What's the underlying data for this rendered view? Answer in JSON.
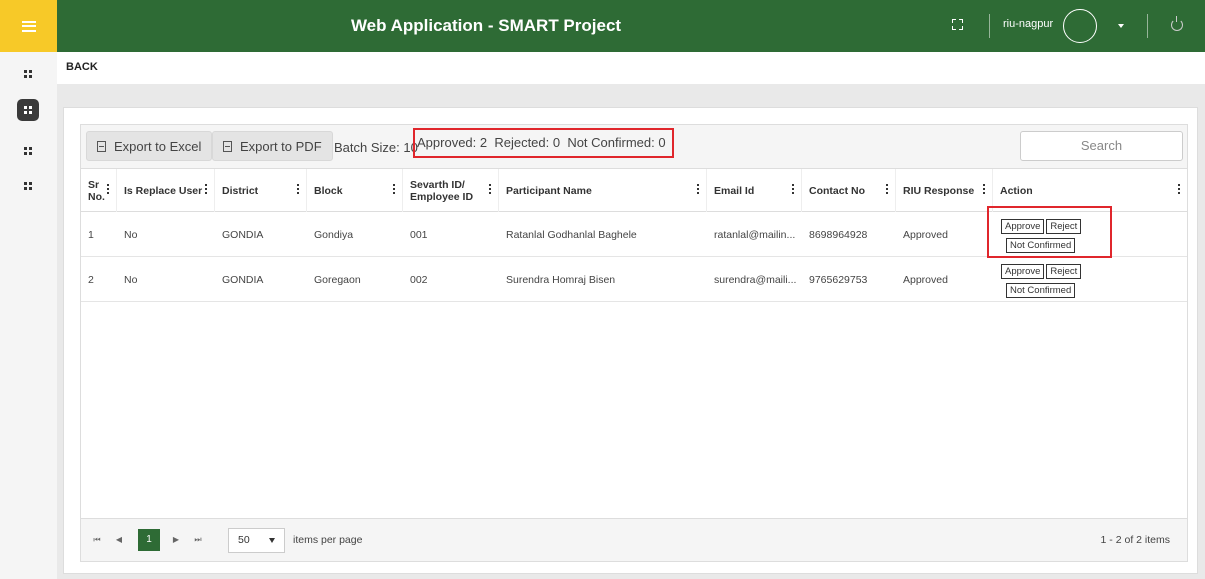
{
  "header": {
    "title": "Web Application - SMART Project",
    "user": "riu-nagpur"
  },
  "nav": {
    "back_label": "BACK"
  },
  "toolbar": {
    "export_excel": "Export to Excel",
    "export_pdf": "Export to PDF",
    "batch_size": "Batch Size: 10",
    "counts": "Approved: 2  Rejected: 0  Not Confirmed: 0",
    "search_placeholder": "Search"
  },
  "table": {
    "columns": [
      "Sr No.",
      "Is Replace User",
      "District",
      "Block",
      "Sevarth ID/ Employee ID",
      "Participant Name",
      "Email Id",
      "Contact No",
      "RIU Response",
      "Action"
    ],
    "rows": [
      [
        "1",
        "No",
        "GONDIA",
        "Gondiya",
        "001",
        "Ratanlal Godhanlal Baghele",
        "ratanlal@mailin...",
        "8698964928",
        "Approved"
      ],
      [
        "2",
        "No",
        "GONDIA",
        "Goregaon",
        "002",
        "Surendra Homraj Bisen",
        "surendra@maili...",
        "9765629753",
        "Approved"
      ]
    ],
    "actions": {
      "approve": "Approve",
      "reject": "Reject",
      "not_confirmed": "Not Confirmed"
    }
  },
  "pager": {
    "current_page": "1",
    "page_size": "50",
    "items_per_page_label": "items per page",
    "info": "1 - 2 of 2 items"
  },
  "colors": {
    "header_green": "#2e6b35",
    "menu_yellow": "#f7c928",
    "highlight_red": "#e0262c"
  }
}
